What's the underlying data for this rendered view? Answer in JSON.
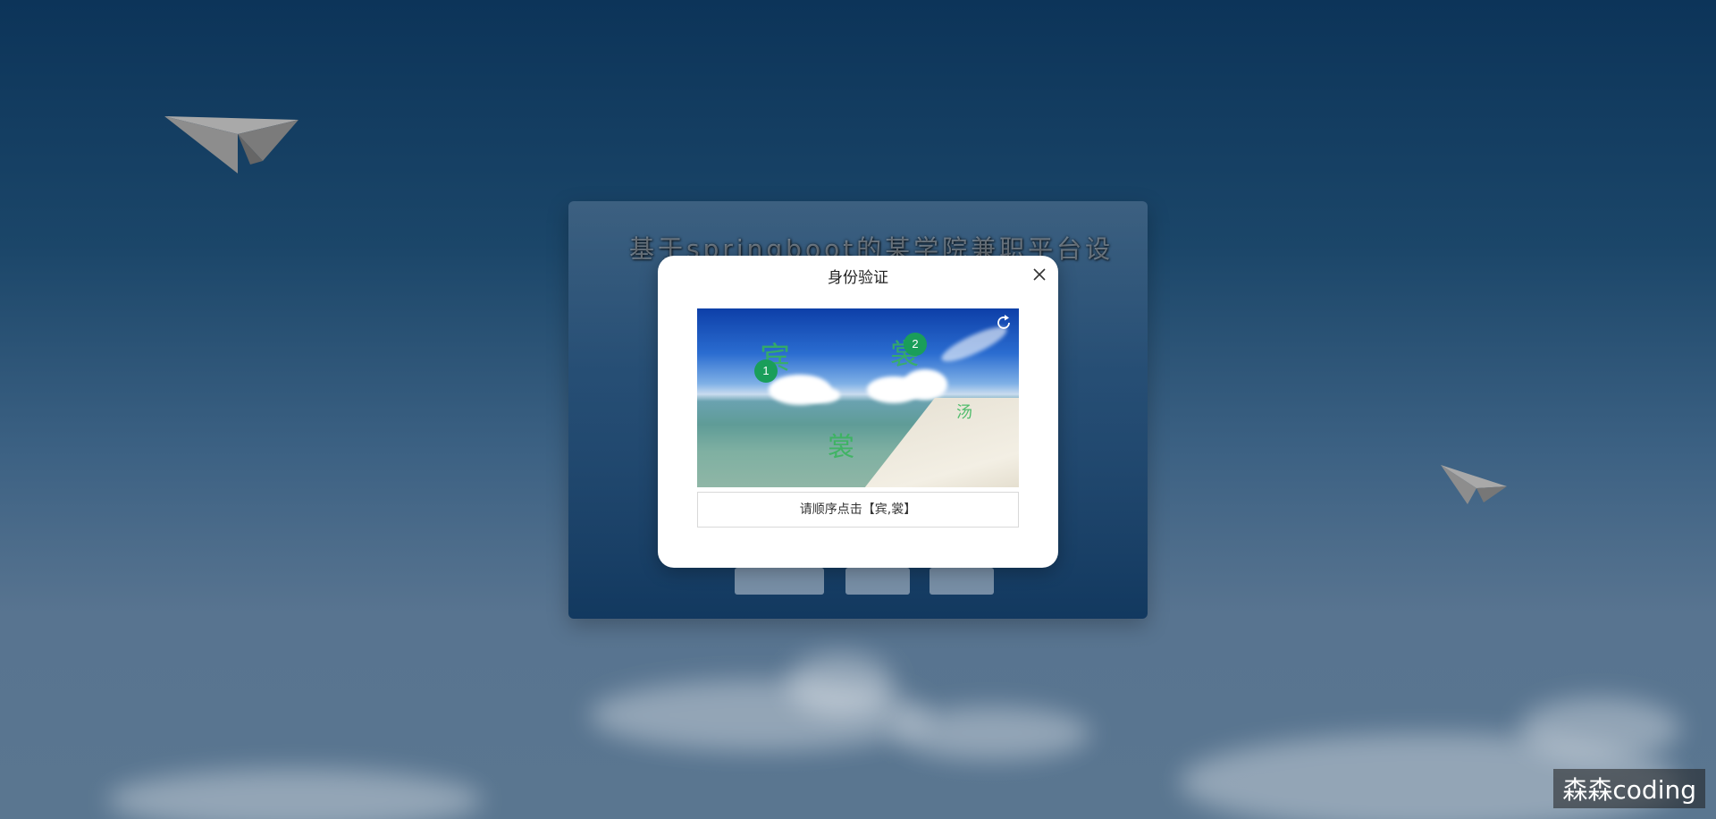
{
  "background": {
    "colors": {
      "sky_top": "#0c3459",
      "sky_bottom": "#5a7690"
    }
  },
  "login_panel": {
    "title": "基于springboot的某学院兼职平台设"
  },
  "modal": {
    "title": "身份验证",
    "close_icon": "close-icon",
    "captcha": {
      "characters": [
        "宾",
        "裳",
        "裳",
        "汤"
      ],
      "markers": [
        "1",
        "2"
      ],
      "refresh_icon": "refresh-icon",
      "prompt": "请顺序点击【宾,裳】",
      "char_color": "#36b55a",
      "marker_color": "#1a9e5a"
    }
  },
  "watermark": "森森coding"
}
